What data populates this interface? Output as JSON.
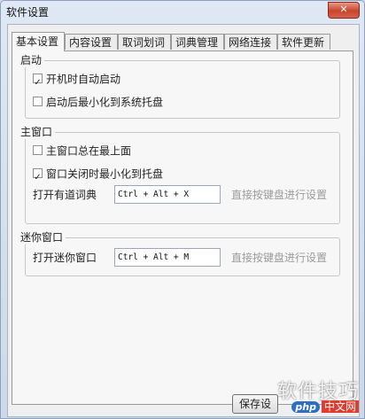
{
  "window": {
    "title": "软件设置",
    "close_glyph": "✕"
  },
  "tabs": [
    {
      "label": "基本设置",
      "active": true
    },
    {
      "label": "内容设置",
      "active": false
    },
    {
      "label": "取词划词",
      "active": false
    },
    {
      "label": "词典管理",
      "active": false
    },
    {
      "label": "网络连接",
      "active": false
    },
    {
      "label": "软件更新",
      "active": false
    }
  ],
  "groups": {
    "startup": {
      "label": "启动",
      "options": [
        {
          "label": "开机时自动启动",
          "checked": true
        },
        {
          "label": "启动后最小化到系统托盘",
          "checked": false
        }
      ]
    },
    "main_window": {
      "label": "主窗口",
      "options": [
        {
          "label": "主窗口总在最上面",
          "checked": false
        },
        {
          "label": "窗口关闭时最小化到托盘",
          "checked": true
        }
      ],
      "hotkey_label": "打开有道词典",
      "hotkey_value": "Ctrl + Alt + X",
      "hotkey_hint": "直接按键盘进行设置"
    },
    "mini_window": {
      "label": "迷你窗口",
      "hotkey_label": "打开迷你窗口",
      "hotkey_value": "Ctrl + Alt + M",
      "hotkey_hint": "直接按键盘进行设置"
    }
  },
  "footer": {
    "save_label": "保存设"
  },
  "watermark": {
    "main": "软件技巧",
    "logo": "php",
    "cn": "中文网"
  },
  "colors": {
    "title_gradient_top": "#dfe8f4",
    "close_red": "#c9442b",
    "hint_gray": "#9b9b9b"
  }
}
